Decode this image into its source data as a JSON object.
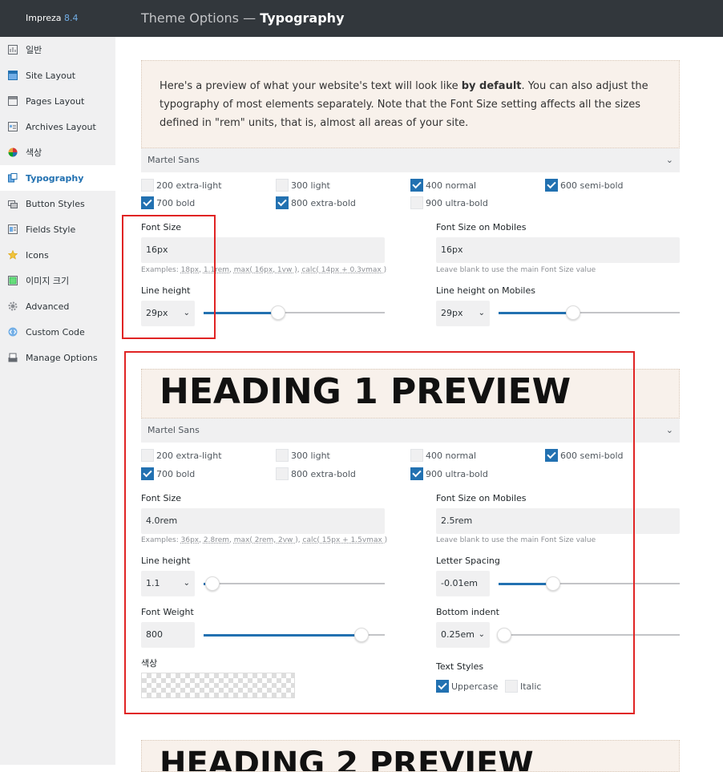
{
  "app": {
    "name": "Impreza",
    "version": "8.4"
  },
  "header": {
    "prefix": "Theme Options — ",
    "title": "Typography"
  },
  "sidebar": {
    "items": [
      {
        "label": "일반",
        "icon": "general-icon"
      },
      {
        "label": "Site Layout",
        "icon": "site-layout-icon"
      },
      {
        "label": "Pages Layout",
        "icon": "pages-layout-icon"
      },
      {
        "label": "Archives Layout",
        "icon": "archives-layout-icon"
      },
      {
        "label": "색상",
        "icon": "color-wheel-icon"
      },
      {
        "label": "Typography",
        "icon": "typography-icon",
        "active": true
      },
      {
        "label": "Button Styles",
        "icon": "button-styles-icon"
      },
      {
        "label": "Fields Style",
        "icon": "fields-style-icon"
      },
      {
        "label": "Icons",
        "icon": "star-icon"
      },
      {
        "label": "이미지 크기",
        "icon": "image-size-icon"
      },
      {
        "label": "Advanced",
        "icon": "gear-icon"
      },
      {
        "label": "Custom Code",
        "icon": "code-icon"
      },
      {
        "label": "Manage Options",
        "icon": "manage-options-icon"
      }
    ]
  },
  "intro": {
    "text_a": "Here's a preview of what your website's text will look like ",
    "text_bold": "by default",
    "text_b": ". You can also adjust the typography of most elements separately. Note that the Font Size setting affects all the sizes defined in \"rem\" units, that is, almost all areas of your site."
  },
  "body_font": {
    "family": "Martel Sans",
    "weights": [
      {
        "label": "200 extra-light",
        "checked": false
      },
      {
        "label": "300 light",
        "checked": false
      },
      {
        "label": "400 normal",
        "checked": true
      },
      {
        "label": "600 semi-bold",
        "checked": true
      },
      {
        "label": "700 bold",
        "checked": true
      },
      {
        "label": "800 extra-bold",
        "checked": true
      },
      {
        "label": "900 ultra-bold",
        "checked": false
      }
    ],
    "font_size_label": "Font Size",
    "font_size": "16px",
    "font_size_examples_prefix": "Examples: ",
    "font_size_examples": [
      "18px",
      "1.1rem",
      "max( 16px, 1vw )",
      "calc( 14px + 0.3vmax )"
    ],
    "font_size_mobile_label": "Font Size on Mobiles",
    "font_size_mobile": "16px",
    "mobile_hint": "Leave blank to use the main Font Size value",
    "line_height_label": "Line height",
    "line_height": "29px",
    "line_height_slider": 0.41,
    "line_height_mobile_label": "Line height on Mobiles",
    "line_height_mobile": "29px",
    "line_height_mobile_slider": 0.41
  },
  "h1": {
    "preview": "HEADING 1 PREVIEW",
    "family": "Martel Sans",
    "weights": [
      {
        "label": "200 extra-light",
        "checked": false
      },
      {
        "label": "300 light",
        "checked": false
      },
      {
        "label": "400 normal",
        "checked": false
      },
      {
        "label": "600 semi-bold",
        "checked": true
      },
      {
        "label": "700 bold",
        "checked": true
      },
      {
        "label": "800 extra-bold",
        "checked": false
      },
      {
        "label": "900 ultra-bold",
        "checked": true
      }
    ],
    "font_size_label": "Font Size",
    "font_size": "4.0rem",
    "font_size_examples_prefix": "Examples: ",
    "font_size_examples": [
      "36px",
      "2.8rem",
      "max( 2rem, 2vw )",
      "calc( 15px + 1.5vmax )"
    ],
    "font_size_mobile_label": "Font Size on Mobiles",
    "font_size_mobile": "2.5rem",
    "mobile_hint": "Leave blank to use the main Font Size value",
    "line_height_label": "Line height",
    "line_height": "1.1",
    "line_height_slider": 0.05,
    "letter_spacing_label": "Letter Spacing",
    "letter_spacing": "-0.01em",
    "letter_spacing_slider": 0.3,
    "font_weight_label": "Font Weight",
    "font_weight": "800",
    "font_weight_slider": 0.87,
    "bottom_indent_label": "Bottom indent",
    "bottom_indent": "0.25em",
    "bottom_indent_slider": 0.03,
    "color_label": "색상",
    "text_styles_label": "Text Styles",
    "uppercase_label": "Uppercase",
    "uppercase": true,
    "italic_label": "Italic",
    "italic": false
  },
  "h2": {
    "preview": "HEADING 2 PREVIEW"
  },
  "colors": {
    "accent": "#2271b1",
    "highlight_box": "#e02424",
    "sidebar_bg": "#f0f0f1",
    "topbar_bg": "#32373c"
  }
}
